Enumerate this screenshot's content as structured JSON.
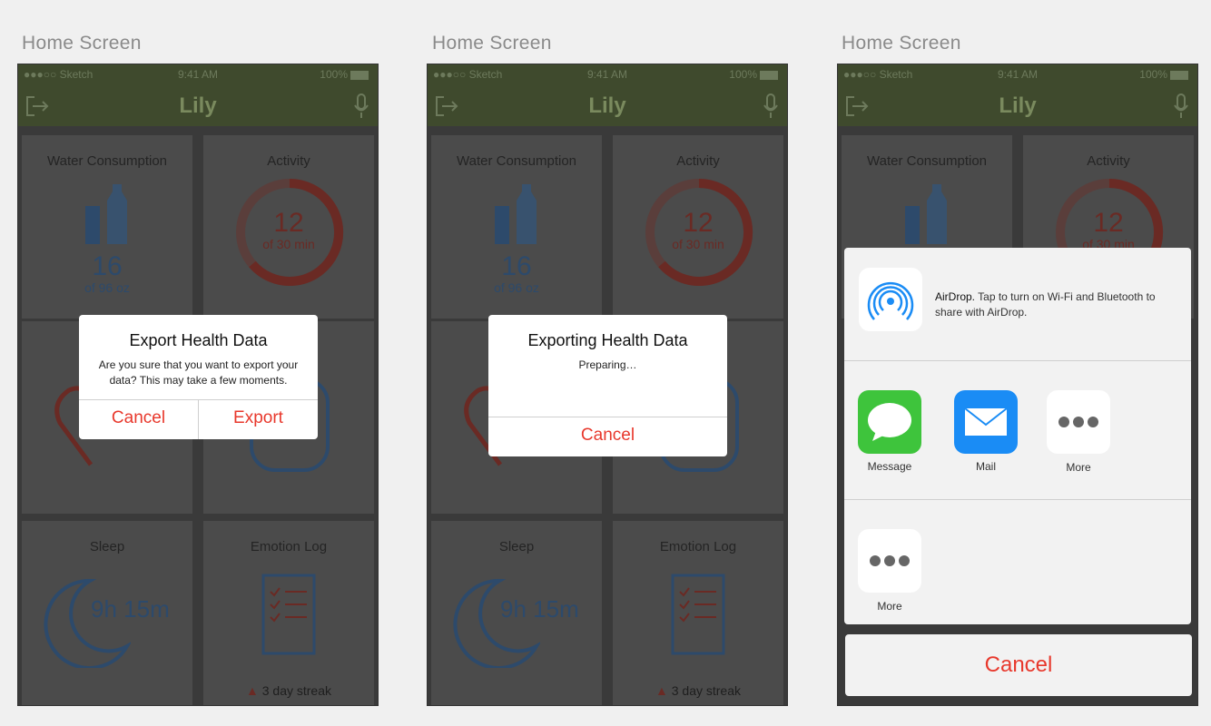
{
  "artboards": [
    {
      "label": "Home Screen"
    },
    {
      "label": "Home Screen"
    },
    {
      "label": "Home Screen"
    }
  ],
  "status_bar": {
    "carrier": "●●●○○ Sketch",
    "time": "9:41 AM",
    "battery": "100%"
  },
  "nav": {
    "title": "Lily"
  },
  "tiles": {
    "water": {
      "title": "Water Consumption",
      "value": "16",
      "unit": "of 96 oz"
    },
    "activity": {
      "title": "Activity",
      "value": "12",
      "unit": "of 30 min"
    },
    "sleep": {
      "title": "Sleep",
      "value": "9h 15m"
    },
    "emotion": {
      "title": "Emotion Log",
      "streak": "3 day streak"
    }
  },
  "dialog_export": {
    "title": "Export Health Data",
    "message": "Are you sure that you want to export your data? This may take a few moments.",
    "cancel": "Cancel",
    "confirm": "Export"
  },
  "dialog_exporting": {
    "title": "Exporting Health Data",
    "message": "Preparing…",
    "cancel": "Cancel"
  },
  "share_sheet": {
    "airdrop_name": "AirDrop.",
    "airdrop_text": "Tap to turn on Wi-Fi and Bluetooth to share with AirDrop.",
    "apps": [
      {
        "label": "Message"
      },
      {
        "label": "Mail"
      },
      {
        "label": "More"
      }
    ],
    "actions": [
      {
        "label": "More"
      }
    ],
    "cancel": "Cancel"
  },
  "colors": {
    "accent_red": "#e8382c",
    "nav_green": "#3f4a2d",
    "water_blue": "#2d4a6b",
    "message_green": "#3ec43c",
    "mail_blue": "#1a8cf5"
  }
}
